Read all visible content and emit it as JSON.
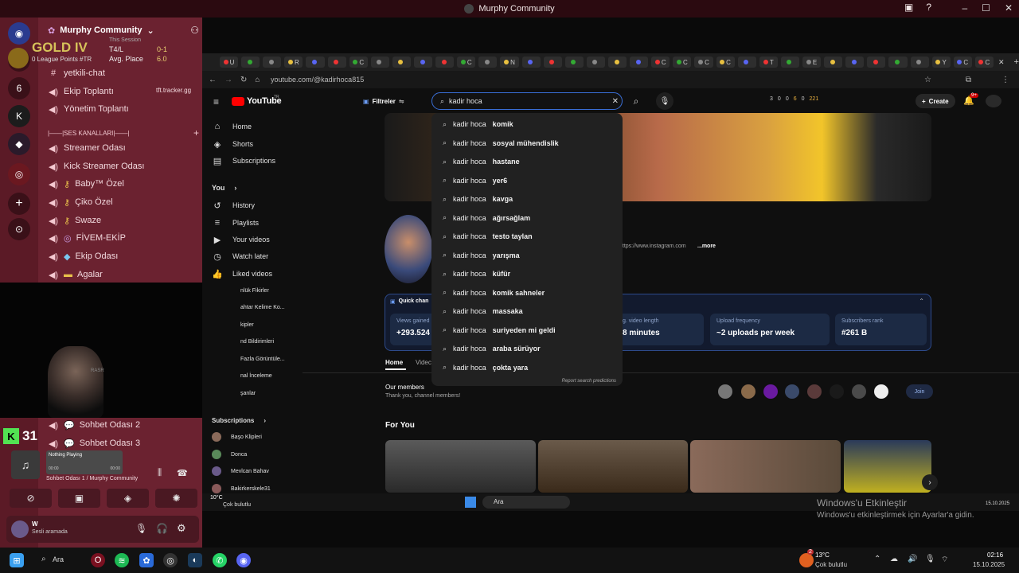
{
  "app_bar": {
    "title": "Murphy Community"
  },
  "discord": {
    "server_name": "Murphy Community",
    "overlay": {
      "rank": "GOLD IV",
      "league_points": "0 League Points #TR",
      "session_label": "This Session",
      "tl_label": "T4/L",
      "tl_value": "0-1",
      "avg_label": "Avg. Place",
      "avg_value": "6.0",
      "tracker": "tft.tracker.gg"
    },
    "text_channels": [
      "yetkili-chat",
      "Ekip Toplantı",
      "Yönetim Toplantı"
    ],
    "category": "|——|SES KANALLARI|——|",
    "voice_channels": [
      "Streamer Odası",
      "Kick Streamer Odası",
      "Baby™ Özel",
      "Çiko Özel",
      "Swaze",
      "FİVEM-EKİP",
      "Ekip Odası",
      "Agalar",
      "Sohbet Odası 2",
      "Sohbet Odası 3"
    ],
    "kick_count": "31",
    "now_playing": {
      "title": "Nothing Playing",
      "time_start": "00:00",
      "time_end": "00:00",
      "channel": "Sohbet Odası 1 / Murphy Community"
    },
    "user": {
      "name": "W",
      "status": "Sesli aramada"
    },
    "webcam_badge": "RASR"
  },
  "browser": {
    "url": "youtube.com/@kadirhoca815",
    "tab_letters": [
      "U",
      "",
      "",
      "R",
      "",
      "",
      "C",
      "",
      "",
      "",
      "",
      "C",
      "",
      "N",
      "",
      "",
      "",
      "",
      "",
      "",
      "C",
      "C",
      "C",
      "C",
      "",
      "T",
      "",
      "E",
      "",
      "",
      "",
      "",
      "",
      "Y",
      "C",
      "C"
    ]
  },
  "youtube": {
    "logo": "YouTube",
    "logo_region": "TR",
    "filters_label": "Filtreler",
    "search_value": "kadir hoca",
    "create_label": "Create",
    "notif_count": "9+",
    "ext_stats": [
      "3",
      "0",
      "0",
      "6",
      "0",
      "221"
    ],
    "sidebar": {
      "main": [
        "Home",
        "Shorts",
        "Subscriptions"
      ],
      "you_label": "You",
      "you_items": [
        "History",
        "Playlists",
        "Your videos",
        "Watch later",
        "Liked videos"
      ],
      "extra_items": [
        "nlük Fikirler",
        "ahtar Kelime Ko...",
        "kipler",
        "nd Bildirimleri",
        "Fazla Görüntüle...",
        "nal İnceleme",
        "şanlar"
      ],
      "subs_label": "Subscriptions",
      "subs": [
        "Başo Klipleri",
        "Donca",
        "Mevlcan Bahav",
        "Bakirkerskele31"
      ]
    },
    "suggestions": [
      {
        "prefix": "kadir hoca",
        "bold": "komik"
      },
      {
        "prefix": "kadir hoca",
        "bold": "sosyal mühendislik"
      },
      {
        "prefix": "kadir hoca",
        "bold": "hastane"
      },
      {
        "prefix": "kadir hoca",
        "bold": "yer6"
      },
      {
        "prefix": "kadir hoca",
        "bold": "kavga"
      },
      {
        "prefix": "kadir hoca",
        "bold": "ağırsağlam"
      },
      {
        "prefix": "kadir hoca",
        "bold": "testo taylan"
      },
      {
        "prefix": "kadir hoca",
        "bold": "yarışma"
      },
      {
        "prefix": "kadir hoca",
        "bold": "küfür"
      },
      {
        "prefix": "kadir hoca",
        "bold": "komik sahneler"
      },
      {
        "prefix": "kadir hoca",
        "bold": "massaka"
      },
      {
        "prefix": "kadir hoca",
        "bold": "suriyeden mi geldi"
      },
      {
        "prefix": "kadir hoca",
        "bold": "araba sürüyor"
      },
      {
        "prefix": "kadir hoca",
        "bold": "çokta yara"
      }
    ],
    "report_label": "Report search predictions",
    "channel_link": "https://www.instagram.com",
    "more_label": "...more",
    "quick_label": "Quick chan",
    "stats": [
      {
        "label": "Views gained",
        "value": "+293.524"
      },
      {
        "label": "g. video length",
        "value": "8 minutes"
      },
      {
        "label": "Upload frequency",
        "value": "~2 uploads per week"
      },
      {
        "label": "Subscribers rank",
        "value": "#261 B"
      }
    ],
    "channel_tabs": [
      "Home",
      "Videc"
    ],
    "members_title": "Our members",
    "members_sub": "Thank you, channel members!",
    "join_label": "Join",
    "for_you_label": "For You"
  },
  "inner_taskbar": {
    "temp": "10°C",
    "weather": "Çok bulutlu",
    "search": "Ara",
    "activate_title": "Windows'u Etkinleştir",
    "activate_sub": "Windows'u etkinleştirmek için Ayarlar'a gidin.",
    "date": "15.10.2025"
  },
  "taskbar": {
    "search": "Ara",
    "temp": "13°C",
    "weather": "Çok bulutlu",
    "time": "02:16",
    "date": "15.10.2025",
    "weather_badge": "2"
  }
}
